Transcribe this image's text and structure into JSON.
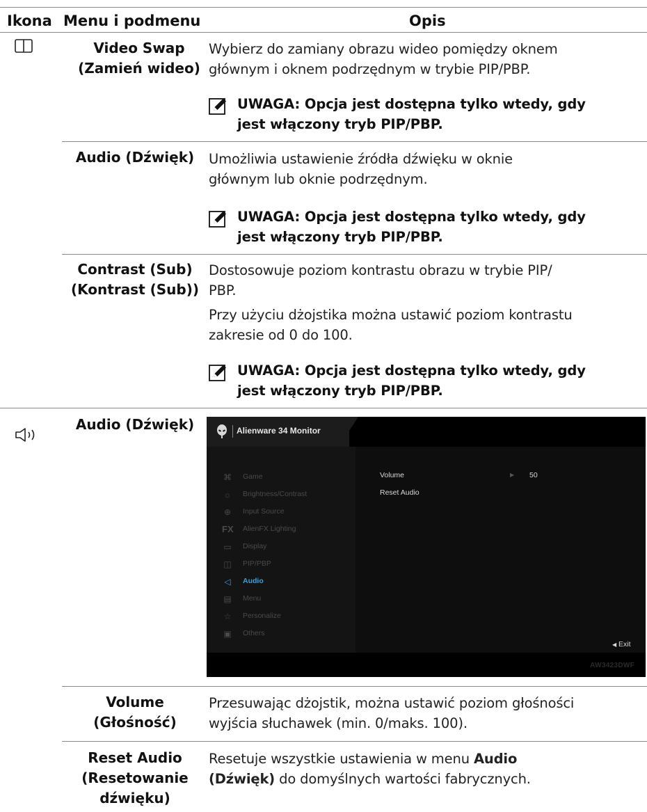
{
  "header": {
    "icon": "Ikona",
    "menu": "Menu i podmenu",
    "desc": "Opis"
  },
  "rows": {
    "video_swap": {
      "icon": "pip-swap-icon",
      "name1": "Video Swap",
      "name2": "(Zamień wideo)",
      "desc1": "Wybierz do zamiany obrazu wideo pomiędzy oknem",
      "desc2": "głównym i oknem podrzędnym w trybie PIP/PBP.",
      "note1": "UWAGA: Opcja jest dostępna tylko wtedy, gdy",
      "note2": "jest włączony tryb PIP/PBP."
    },
    "audio_sub": {
      "name": "Audio (Dźwięk)",
      "desc1": "Umożliwia ustawienie źródła dźwięku w oknie",
      "desc2": "głównym lub oknie podrzędnym.",
      "note1": "UWAGA: Opcja jest dostępna tylko wtedy, gdy",
      "note2": "jest włączony tryb PIP/PBP."
    },
    "contrast_sub": {
      "name1": "Contrast (Sub)",
      "name2": "(Kontrast (Sub))",
      "desc1": "Dostosowuje poziom kontrastu obrazu w trybie PIP/",
      "desc2": "PBP.",
      "desc3": "Przy użyciu dżojstika można ustawić poziom kontrastu",
      "desc4": "zakresie od 0 do 100.",
      "note1": "UWAGA: Opcja jest dostępna tylko wtedy, gdy",
      "note2": "jest włączony tryb PIP/PBP."
    },
    "audio": {
      "icon": "speaker-icon",
      "name": "Audio (Dźwięk)"
    },
    "volume": {
      "name1": "Volume",
      "name2": "(Głośność)",
      "desc1": "Przesuwając dżojstik, można ustawić poziom głośności",
      "desc2": "wyjścia słuchawek (min. 0/maks. 100)."
    },
    "reset_audio": {
      "name1": "Reset Audio",
      "name2": "(Resetowanie",
      "name3": "dźwięku)",
      "desc1_pre": "Resetuje wszystkie ustawienia w menu ",
      "desc1_bold": "Audio",
      "desc2_bold": "(Dźwięk)",
      "desc2_post": " do domyślnych wartości fabrycznych."
    }
  },
  "osd": {
    "title": "Alienware 34 Monitor",
    "menu": [
      {
        "icon": "gamepad-icon",
        "label": "Game"
      },
      {
        "icon": "brightness-icon",
        "label": "Brightness/Contrast"
      },
      {
        "icon": "input-source-icon",
        "label": "Input Source"
      },
      {
        "icon": "alienfx-icon",
        "label": "AlienFX Lighting"
      },
      {
        "icon": "display-icon",
        "label": "Display"
      },
      {
        "icon": "pip-icon",
        "label": "PIP/PBP"
      },
      {
        "icon": "speaker-icon",
        "label": "Audio"
      },
      {
        "icon": "menu-icon",
        "label": "Menu"
      },
      {
        "icon": "star-icon",
        "label": "Personalize"
      },
      {
        "icon": "others-icon",
        "label": "Others"
      }
    ],
    "active": "Audio",
    "volume_label": "Volume",
    "volume_value": "50",
    "reset_label": "Reset Audio",
    "exit_label": "Exit",
    "model": "AW3423DWF",
    "accent": "#2aa4e8"
  }
}
